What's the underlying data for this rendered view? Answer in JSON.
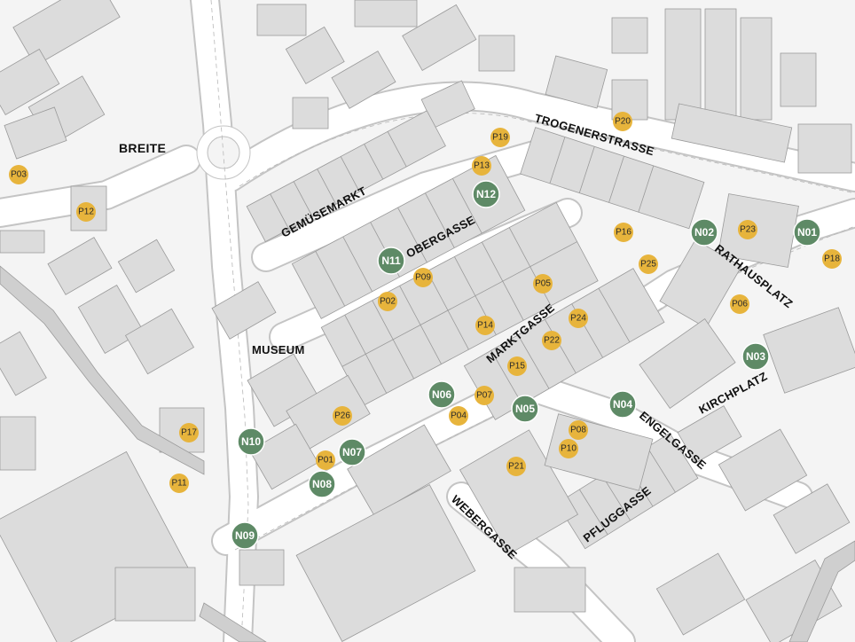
{
  "map": {
    "colors": {
      "background": "#f4f4f4",
      "building": "#dcdcdc",
      "building_outline": "#9a9a9a",
      "road": "#ffffff",
      "n_marker": "#5e8a66",
      "p_marker": "#e7b43c"
    },
    "labels": {
      "breite": "BREITE",
      "trogenerstrasse": "TROGENERSTRASSE",
      "gemuesemarkt": "GEMÜSEMARKT",
      "obergasse": "OBERGASSE",
      "rathausplatz": "RATHAUSPLATZ",
      "marktgasse": "MARKTGASSE",
      "museum": "MUSEUM",
      "kirchplatz": "KIRCHPLATZ",
      "engelgasse": "ENGELGASSE",
      "webergasse": "WEBERGASSE",
      "pfluggasse": "PFLUGGASSE"
    },
    "markers_n": [
      "N01",
      "N02",
      "N03",
      "N04",
      "N05",
      "N06",
      "N07",
      "N08",
      "N09",
      "N10",
      "N11",
      "N12"
    ],
    "markers_p": [
      "P01",
      "P02",
      "P03",
      "P04",
      "P05",
      "P06",
      "P07",
      "P08",
      "P09",
      "P10",
      "P11",
      "P12",
      "P13",
      "P14",
      "P15",
      "P16",
      "P17",
      "P18",
      "P19",
      "P20",
      "P21",
      "P22",
      "P23",
      "P24",
      "P25",
      "P26"
    ]
  }
}
